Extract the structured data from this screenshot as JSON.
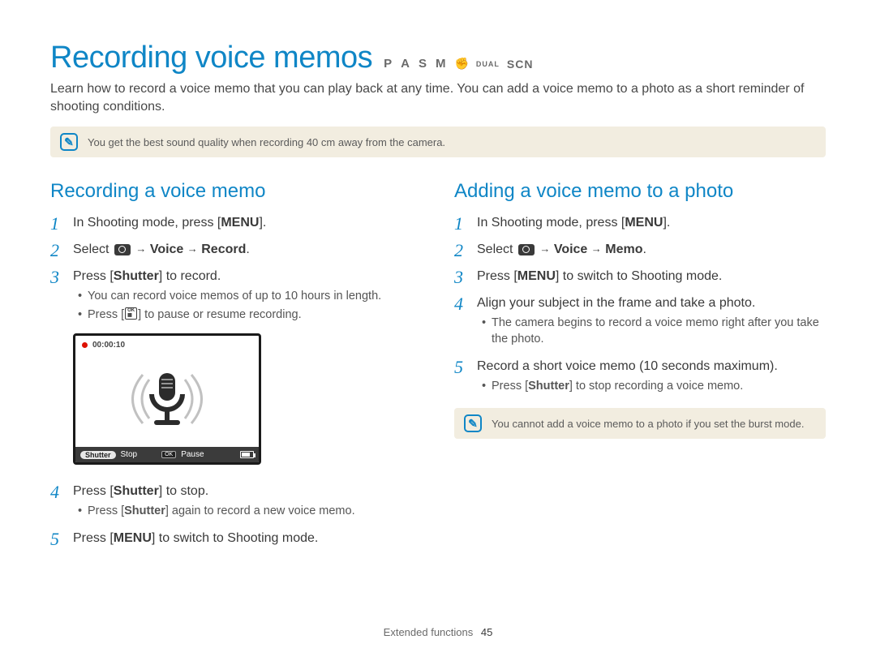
{
  "title": "Recording voice memos",
  "modeIcons": {
    "p": "P",
    "a": "A",
    "s": "S",
    "m": "M",
    "hand": "✊",
    "dual": "DUAL",
    "scn": "SCN"
  },
  "intro": "Learn how to record a voice memo that you can play back at any time. You can add a voice memo to a photo as a short reminder of shooting conditions.",
  "topTip": "You get the best sound quality when recording 40 cm away from the camera.",
  "left": {
    "heading": "Recording a voice memo",
    "steps": {
      "s1_pre": "In Shooting mode, press [",
      "s1_btn": "MENU",
      "s1_post": "].",
      "s2_pre": "Select ",
      "s2_arrow": "→",
      "s2_voice": "Voice",
      "s2_arrow2": "→",
      "s2_record": "Record",
      "s2_end": ".",
      "s3_pre": "Press [",
      "s3_btn": "Shutter",
      "s3_post": "] to record.",
      "s3_sub1": "You can record voice memos of up to 10 hours in length.",
      "s3_sub2_pre": "Press [",
      "s3_sub2_post": "] to pause or resume recording.",
      "s4_pre": "Press [",
      "s4_btn": "Shutter",
      "s4_post": "] to stop.",
      "s4_sub_pre": "Press [",
      "s4_sub_btn": "Shutter",
      "s4_sub_post": "] again to record a new voice memo.",
      "s5_pre": "Press [",
      "s5_btn": "MENU",
      "s5_post": "] to switch to Shooting mode."
    },
    "lcd": {
      "time": "00:00:10",
      "shutterLabel": "Shutter",
      "stop": "Stop",
      "ok": "OK",
      "pause": "Pause"
    }
  },
  "right": {
    "heading": "Adding a voice memo to a photo",
    "steps": {
      "s1_pre": "In Shooting mode, press [",
      "s1_btn": "MENU",
      "s1_post": "].",
      "s2_pre": "Select ",
      "s2_arrow": "→",
      "s2_voice": "Voice",
      "s2_arrow2": "→",
      "s2_memo": "Memo",
      "s2_end": ".",
      "s3_pre": "Press [",
      "s3_btn": "MENU",
      "s3_post": "] to switch to Shooting mode.",
      "s4": "Align your subject in the frame and take a photo.",
      "s4_sub": "The camera begins to record a voice memo right after you take the photo.",
      "s5": "Record a short voice memo (10 seconds maximum).",
      "s5_sub_pre": "Press [",
      "s5_sub_btn": "Shutter",
      "s5_sub_post": "] to stop recording a voice memo."
    },
    "tip": "You cannot add a voice memo to a photo if you set the burst mode."
  },
  "footer": {
    "section": "Extended functions",
    "page": "45"
  }
}
